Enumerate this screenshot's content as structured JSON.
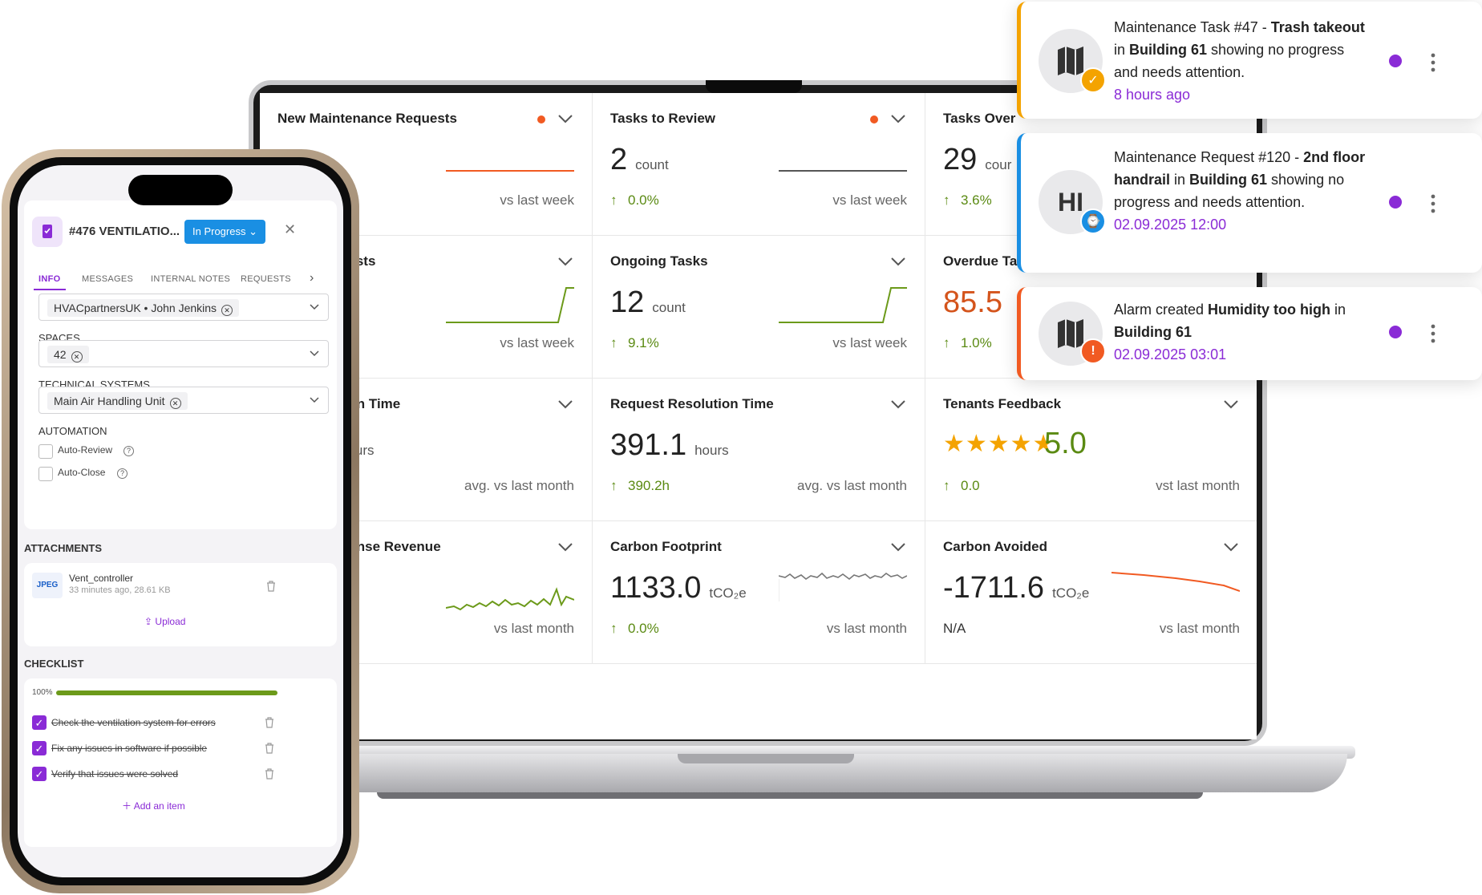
{
  "dashboard": {
    "cards": [
      {
        "title": "New Maintenance Requests",
        "value": "",
        "unit": "",
        "change": "",
        "vs": "vs last week",
        "alert": true
      },
      {
        "title": "Tasks to Review",
        "value": "2",
        "unit": "count",
        "change": "0.0%",
        "vs": "vs last week",
        "alert": true
      },
      {
        "title": "Tasks Over",
        "value": "29",
        "unit": "cour",
        "change": "3.6%",
        "vs": ""
      },
      {
        "title": "uests",
        "value": "",
        "unit": "",
        "change": "",
        "vs": "vs last week"
      },
      {
        "title": "Ongoing Tasks",
        "value": "12",
        "unit": "count",
        "change": "9.1%",
        "vs": "vs last week"
      },
      {
        "title": "Overdue Ta",
        "value": "85.5",
        "unit": "",
        "change": "1.0%",
        "vs": ""
      },
      {
        "title": "tion Time",
        "value": "",
        "unit": "hours",
        "change": "",
        "vs": "avg. vs last month"
      },
      {
        "title": "Request Resolution Time",
        "value": "391.1",
        "unit": "hours",
        "change": "390.2h",
        "vs": "avg. vs last month"
      },
      {
        "title": "Tenants Feedback",
        "value": "5.0",
        "unit": "",
        "change": "0.0",
        "vs": "vst last month",
        "rating": 5
      },
      {
        "title": "ponse Revenue",
        "value": "",
        "unit": "€",
        "change": "",
        "vs": "vs last month"
      },
      {
        "title": "Carbon Footprint",
        "value": "1133.0",
        "unit": "tCO₂e",
        "change": "0.0%",
        "vs": "vs last month"
      },
      {
        "title": "Carbon Avoided",
        "value": "-1711.6",
        "unit": "tCO₂e",
        "change": "N/A",
        "vs": "vs last month"
      }
    ],
    "colors": {
      "positive": "#5a8a12",
      "alert": "#f15a22",
      "overdue": "#d4541c",
      "star": "#f4a300"
    }
  },
  "notifications": [
    {
      "avatar_icon": "building-map-icon",
      "badge_icon": "clipboard-check-icon",
      "badge_color": "#f4a300",
      "border_color": "#f4a300",
      "text_parts": [
        "Maintenance Task #47 - ",
        "Trash takeout",
        " in ",
        "Building 61",
        " showing no progress and needs attention."
      ],
      "time": "8 hours ago"
    },
    {
      "avatar_text": "HI",
      "badge_icon": "person-clock-icon",
      "badge_color": "#1a8fe3",
      "border_color": "#1a8fe3",
      "text_parts": [
        "Maintenance Request #120 - ",
        "2nd floor handrail",
        " in ",
        "Building 61",
        " showing no progress and needs attention."
      ],
      "time": "02.09.2025 12:00"
    },
    {
      "avatar_icon": "building-map-icon",
      "badge_icon": "warning-icon",
      "badge_color": "#f15a22",
      "border_color": "#f15a22",
      "text_parts": [
        "Alarm created ",
        "Humidity too high",
        " in ",
        "Building 61",
        ""
      ],
      "time": "02.09.2025 03:01"
    }
  ],
  "phone": {
    "task_title": "#476 VENTILATIO...",
    "status": "In Progress",
    "tabs": [
      "INFO",
      "MESSAGES",
      "INTERNAL NOTES",
      "REQUESTS"
    ],
    "assignee": "HVACpartnersUK • John Jenkins",
    "spaces_label": "SPACES",
    "space_value": "42",
    "systems_label": "TECHNICAL SYSTEMS",
    "system_value": "Main Air Handling Unit",
    "automation_label": "AUTOMATION",
    "auto_review": "Auto-Review",
    "auto_close": "Auto-Close",
    "attachments_label": "ATTACHMENTS",
    "file_type": "JPEG",
    "file_name": "Vent_controller",
    "file_meta": "33 minutes ago, 28.61 KB",
    "upload": "Upload",
    "checklist_label": "CHECKLIST",
    "progress_text": "100%",
    "progress": 1.0,
    "checklist": [
      "Check the ventilation system for errors",
      "Fix any issues in software if possible",
      "Verify that issues were solved"
    ],
    "add_item": "Add an item"
  }
}
